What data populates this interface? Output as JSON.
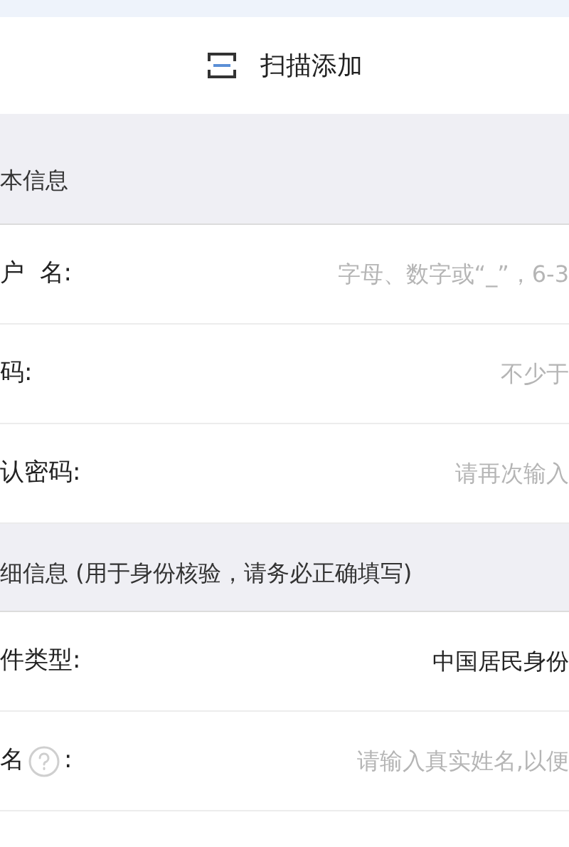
{
  "scan_button": {
    "label": "扫描添加"
  },
  "sections": [
    {
      "title": "本信息",
      "fields": [
        {
          "kind": "input",
          "label": "户  名:",
          "placeholder": "字母、数字或“_”，6-3"
        },
        {
          "kind": "input",
          "label": "码:",
          "placeholder": "不少于"
        },
        {
          "kind": "input",
          "label": "认密码:",
          "placeholder": "请再次输入"
        }
      ]
    },
    {
      "title": "细信息 (用于身份核验，请务必正确填写)",
      "fields": [
        {
          "kind": "select",
          "label": "件类型:",
          "value": "中国居民身份"
        },
        {
          "kind": "input",
          "label": "名",
          "help": true,
          "label_suffix": ":",
          "placeholder": "请输入真实姓名,以便"
        }
      ]
    }
  ]
}
